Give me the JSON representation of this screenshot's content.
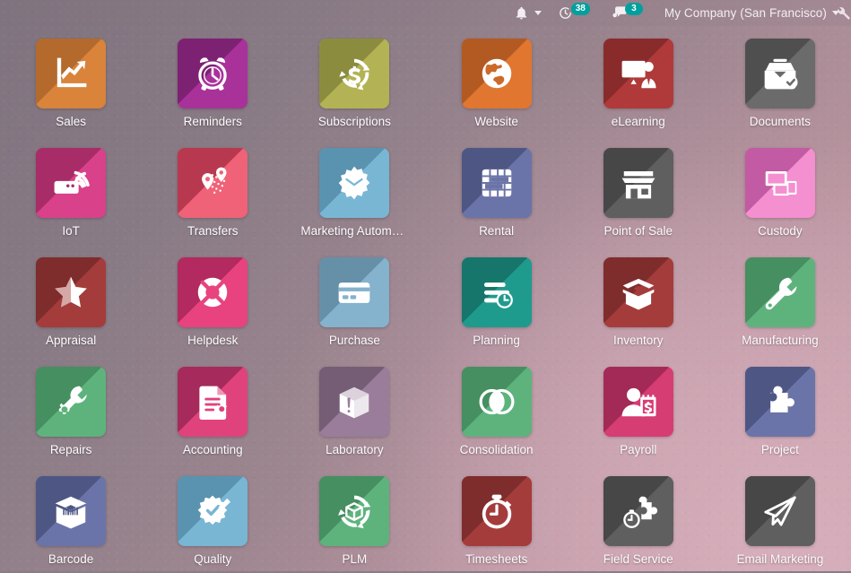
{
  "systray": {
    "activities_icon": "clock-activities-icon",
    "activities_count": "38",
    "messages_icon": "chat-messages-icon",
    "messages_count": "3",
    "notification_icon": "bell-icon",
    "company_label": "My Company (San Francisco)",
    "settings_icon": "wrench-icon",
    "badge_color": "#00a09d"
  },
  "apps": [
    {
      "label": "Sales",
      "icon": "sales-chart-icon",
      "color": "#d9833b",
      "shade": "#b36a2c"
    },
    {
      "label": "Reminders",
      "icon": "alarm-clock-icon",
      "color": "#a8329a",
      "shade": "#7d2272"
    },
    {
      "label": "Subscriptions",
      "icon": "dollar-recycle-icon",
      "color": "#b3b355",
      "shade": "#8c8c3f"
    },
    {
      "label": "Website",
      "icon": "globe-icon",
      "color": "#e0762f",
      "shade": "#b35a22"
    },
    {
      "label": "eLearning",
      "icon": "presentation-teacher-icon",
      "color": "#b03a3a",
      "shade": "#8a2b2b"
    },
    {
      "label": "Documents",
      "icon": "document-box-check-icon",
      "color": "#6b6b6b",
      "shade": "#4f4f4f"
    },
    {
      "label": "IoT",
      "icon": "iot-wifi-box-icon",
      "color": "#d9418a",
      "shade": "#a82c68"
    },
    {
      "label": "Transfers",
      "icon": "map-pins-icon",
      "color": "#ef6277",
      "shade": "#b8394f"
    },
    {
      "label": "Marketing Automat…",
      "icon": "gear-envelope-icon",
      "color": "#79b6d4",
      "shade": "#5a93b0"
    },
    {
      "label": "Rental",
      "icon": "calendar-grid-icon",
      "color": "#6b74a8",
      "shade": "#4e5684"
    },
    {
      "label": "Point of Sale",
      "icon": "shop-icon",
      "color": "#5f5f5f",
      "shade": "#474747"
    },
    {
      "label": "Custody",
      "icon": "screens-icon",
      "color": "#f48fd0",
      "shade": "#c25ba3"
    },
    {
      "label": "Appraisal",
      "icon": "half-star-icon",
      "color": "#a53c3c",
      "shade": "#7f2c2c"
    },
    {
      "label": "Helpdesk",
      "icon": "lifebuoy-icon",
      "color": "#e8437f",
      "shade": "#b22a5f"
    },
    {
      "label": "Purchase",
      "icon": "credit-card-icon",
      "color": "#85b2cc",
      "shade": "#6690a8"
    },
    {
      "label": "Planning",
      "icon": "tasks-clock-icon",
      "color": "#1f9b8e",
      "shade": "#16766c"
    },
    {
      "label": "Inventory",
      "icon": "open-box-icon",
      "color": "#a53c3c",
      "shade": "#7f2c2c"
    },
    {
      "label": "Manufacturing",
      "icon": "wrench-icon",
      "color": "#5eb37d",
      "shade": "#468f60"
    },
    {
      "label": "Repairs",
      "icon": "wrench-gear-icon",
      "color": "#5eb37d",
      "shade": "#468f60"
    },
    {
      "label": "Accounting",
      "icon": "document-gear-icon",
      "color": "#e0437c",
      "shade": "#a62a5c"
    },
    {
      "label": "Laboratory",
      "icon": "cube-alert-icon",
      "color": "#9a7d9a",
      "shade": "#755d75"
    },
    {
      "label": "Consolidation",
      "icon": "venn-circles-icon",
      "color": "#5eb37d",
      "shade": "#468f60"
    },
    {
      "label": "Payroll",
      "icon": "person-payslip-icon",
      "color": "#d63d73",
      "shade": "#a32a56"
    },
    {
      "label": "Project",
      "icon": "puzzle-piece-icon",
      "color": "#6b74a8",
      "shade": "#4e5684"
    },
    {
      "label": "Barcode",
      "icon": "barcode-box-icon",
      "color": "#6b74a8",
      "shade": "#4e5684"
    },
    {
      "label": "Quality",
      "icon": "quality-badge-pencil-icon",
      "color": "#79b6d4",
      "shade": "#5a93b0"
    },
    {
      "label": "PLM",
      "icon": "cube-recycle-icon",
      "color": "#5eb37d",
      "shade": "#468f60"
    },
    {
      "label": "Timesheets",
      "icon": "stopwatch-icon",
      "color": "#a53c3c",
      "shade": "#7f2c2c"
    },
    {
      "label": "Field Service",
      "icon": "puzzle-stopwatch-icon",
      "color": "#5f5f5f",
      "shade": "#474747"
    },
    {
      "label": "Email Marketing",
      "icon": "paper-plane-icon",
      "color": "#5f5f5f",
      "shade": "#474747"
    }
  ]
}
